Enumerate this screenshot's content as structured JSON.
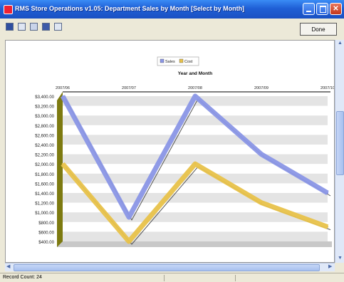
{
  "window": {
    "title": "RMS Store Operations v1.05: Department Sales by Month [Select by Month]",
    "done_label": "Done",
    "status": "Record Count: 24"
  },
  "toolbar": {
    "icons": [
      "save-icon",
      "print-icon",
      "print-preview-icon",
      "export-icon",
      "copy-icon"
    ]
  },
  "chart_data": {
    "type": "line",
    "title": "Year and Month",
    "categories": [
      "2007/06",
      "2007/07",
      "2007/08",
      "2007/09",
      "2007/10"
    ],
    "y_tick_labels": [
      "$3,400.00",
      "$3,200.00",
      "$3,000.00",
      "$2,800.00",
      "$2,600.00",
      "$2,400.00",
      "$2,200.00",
      "$2,000.00",
      "$1,800.00",
      "$1,600.00",
      "$1,400.00",
      "$1,200.00",
      "$1,000.00",
      "$800.00",
      "$600.00",
      "$400.00"
    ],
    "ylim": [
      400,
      3400
    ],
    "x_axis_position": "top",
    "legend_position": "top-center",
    "grid": true,
    "series": [
      {
        "name": "Sales",
        "color": "#8a96e6",
        "values": [
          3400,
          900,
          3400,
          2200,
          1400
        ]
      },
      {
        "name": "Cost",
        "color": "#e8c24a",
        "values": [
          2000,
          400,
          2000,
          1200,
          700
        ]
      }
    ]
  }
}
